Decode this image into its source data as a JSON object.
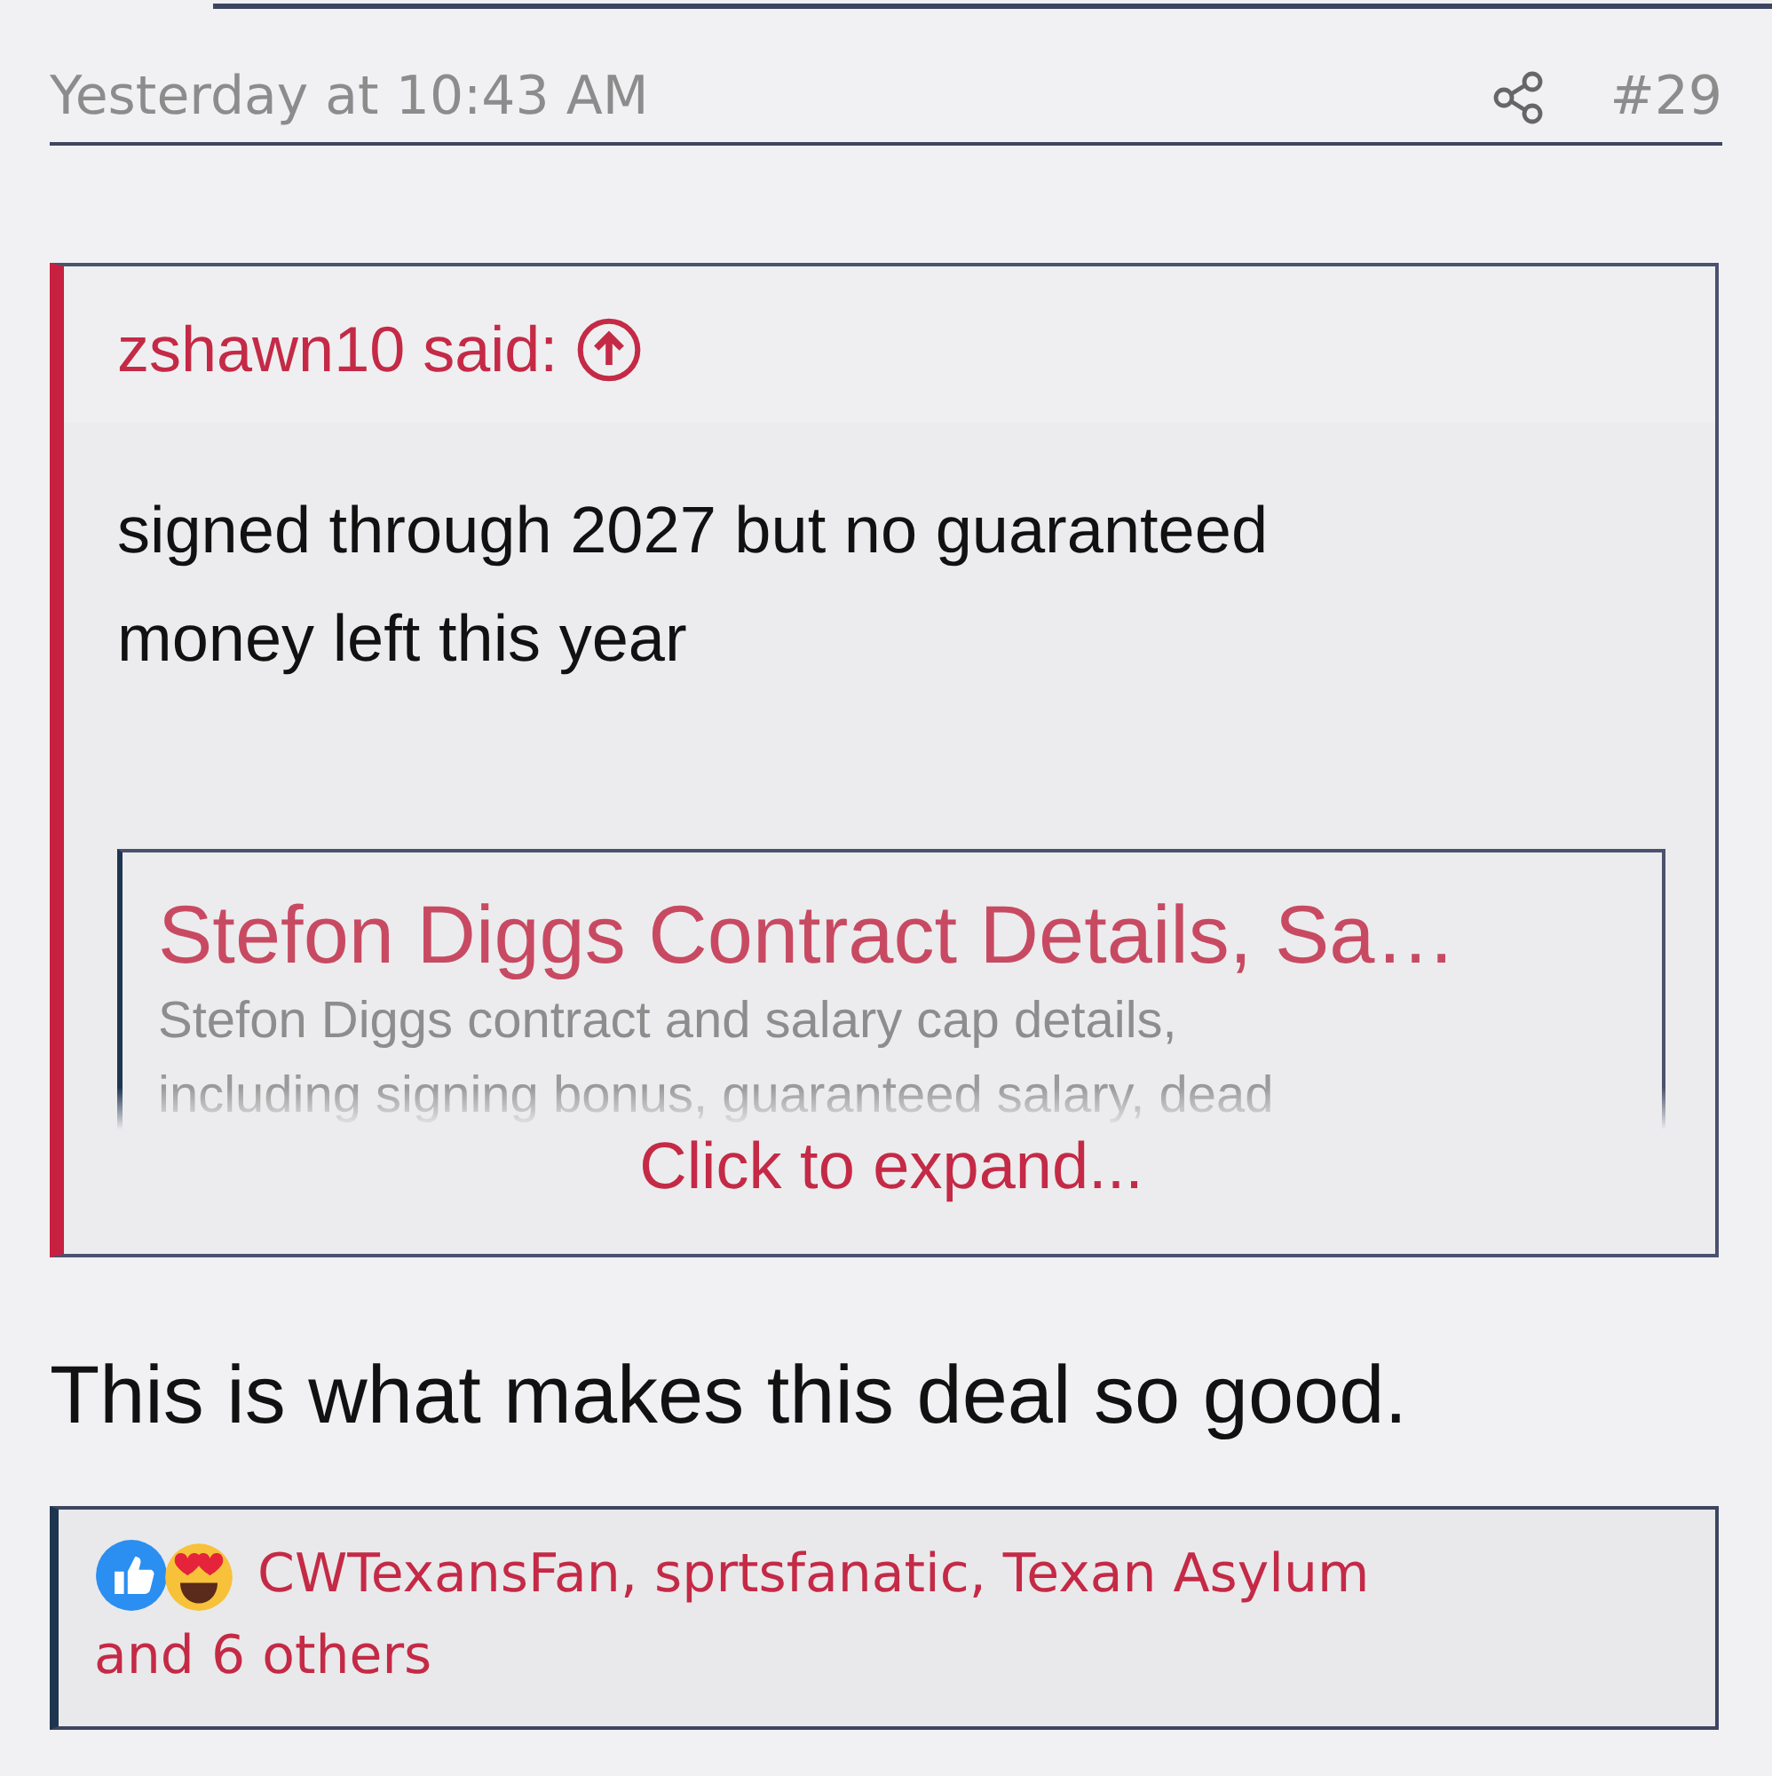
{
  "post": {
    "timestamp": "Yesterday at 10:43 AM",
    "number": "#29"
  },
  "quote": {
    "author_line": "zshawn10 said:",
    "text_lines": [
      "signed through 2027 but no guaranteed",
      "money left this year"
    ],
    "embed": {
      "title": "Stefon Diggs Contract Details, Sa…",
      "description_lines": [
        "Stefon Diggs contract and salary cap details,",
        "including signing bonus, guaranteed salary, dead"
      ]
    },
    "expand_link": "Click to expand..."
  },
  "message": "This is what makes this deal so good.",
  "reactions": {
    "types": [
      {
        "kind": "like"
      },
      {
        "kind": "love"
      }
    ],
    "names": "CWTexansFan, sprtsfanatic, Texan Asylum",
    "others": "and 6 others"
  }
}
